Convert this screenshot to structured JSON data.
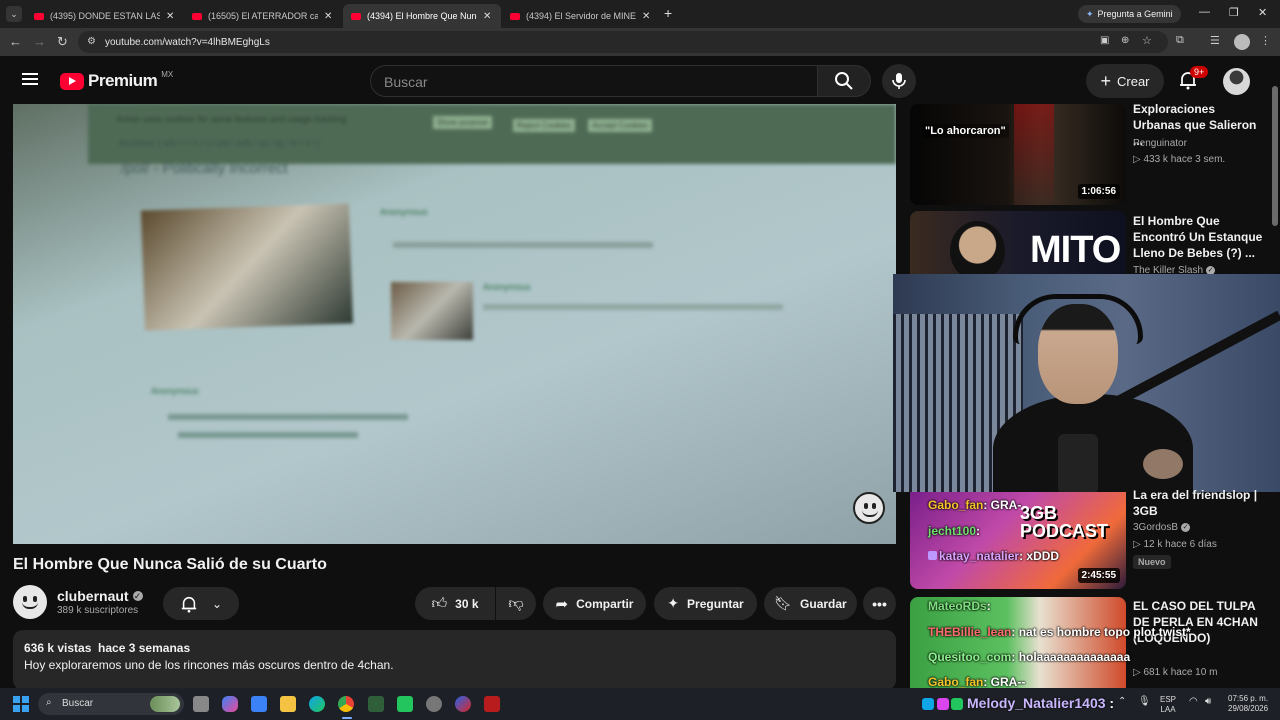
{
  "browser": {
    "tabs": [
      {
        "title": "(4395) DONDE ESTAN LAS RUBI"
      },
      {
        "title": "(16505) El ATERRADOR caso de"
      },
      {
        "title": "(4394) El Hombre Que Nunca S"
      },
      {
        "title": "(4394) El Servidor de MINECRA"
      }
    ],
    "gemini_label": "Pregunta a Gemini",
    "url": "youtube.com/watch?v=4lhBMEghgLs"
  },
  "youtube": {
    "logo_text": "Premium",
    "region": "MX",
    "search_placeholder": "Buscar",
    "create_label": "Crear",
    "notif_badge": "9+"
  },
  "video": {
    "title": "El Hombre Que Nunca Salió de su Cuarto",
    "channel": "clubernaut",
    "subscribers": "389 k suscriptores",
    "likes": "30 k",
    "share_label": "Compartir",
    "ask_label": "Preguntar",
    "save_label": "Guardar",
    "views_date": "636 k vistas  hace 3 semanas",
    "description": "Hoy exploraremos uno de los rincones más oscuros dentro de 4chan.",
    "screen_text": {
      "cookie": "4chan uses cookies for some features and usage tracking.",
      "btn1": "Show purpose",
      "btn2": "Reject Cookies",
      "btn3": "Accept Cookies",
      "archives": "Archives: [ a/b / l / h / s / pol / w/b / sp / tg / tv / x / ]",
      "board": "/pol/ - Politically Incorrect",
      "anon": "Anonymous"
    }
  },
  "sidebar": [
    {
      "title": "Exploraciones Urbanas que Salieron ...",
      "channel": "Penguinator",
      "meta": "▷ 433 k  hace 3 sem.",
      "duration": "1:06:56",
      "thumb_text": "\"Lo ahorcaron\""
    },
    {
      "title": "El Hombre Que Encontró Un Estanque Lleno De Bebes (?) ...",
      "channel": "The Killer Slash",
      "thumb_text": "MITO"
    },
    {
      "title": "La era del friendslop | 3GB",
      "channel": "3GordosB",
      "meta": "▷ 12 k  hace 6 días",
      "duration": "2:45:55",
      "badge": "Nuevo",
      "thumb_text": "3GB PODCAST"
    },
    {
      "title": "EL CASO DEL TULPA DE PERLA EN 4CHAN (LOQUENDO)",
      "channel": "",
      "meta": "▷ 681 k  hace 10 m"
    }
  ],
  "chat": [
    {
      "user": "Gabo_fan",
      "msg": ": GRA-",
      "color": "#f7c42c"
    },
    {
      "user": "jecht100",
      "msg": ":",
      "color": "#6ee06e"
    },
    {
      "user": "katay_natalier",
      "msg": ": xDDD",
      "color": "#d9a4ff"
    },
    {
      "user": "MateoRDs",
      "msg": ":",
      "color": "#7fe07f"
    },
    {
      "user": "THEBillie_lean",
      "msg": ": nat es hombre topo plot twist*",
      "color": "#ff6c6c"
    },
    {
      "user": "Quesitoo_com",
      "msg": ": holaaaaaaaaaaaaaa",
      "color": "#8ef08e"
    },
    {
      "user": "Gabo_fan",
      "msg": ": GRA--",
      "color": "#f7c42c"
    }
  ],
  "taskbar": {
    "search_label": "Buscar",
    "overlay_user": "Melody_Natalier1403",
    "lang": "ESP",
    "lang2": "LAA",
    "time": "07:56 p. m.",
    "date": "29/08/2026"
  }
}
